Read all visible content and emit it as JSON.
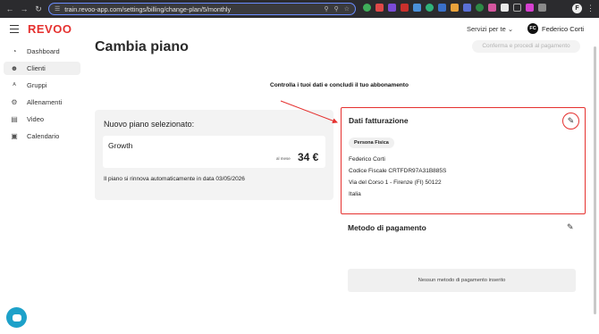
{
  "browser": {
    "url": "train.revoo-app.com/settings/billing/change-plan/5/monthly",
    "back_icon": "arrow-left-icon",
    "forward_icon": "arrow-right-icon",
    "reload_icon": "reload-icon",
    "profile_initial": "F"
  },
  "header": {
    "logo": "REVOO",
    "services_label": "Servizi per te",
    "user_initials": "FC",
    "user_name": "Federico Corti"
  },
  "sidebar": {
    "items": [
      {
        "label": "Dashboard",
        "icon": "dashboard-icon"
      },
      {
        "label": "Clienti",
        "icon": "user-icon"
      },
      {
        "label": "Gruppi",
        "icon": "group-icon"
      },
      {
        "label": "Allenamenti",
        "icon": "workout-icon"
      },
      {
        "label": "Video",
        "icon": "video-icon"
      },
      {
        "label": "Calendario",
        "icon": "calendar-icon"
      }
    ],
    "active_index": 1
  },
  "main": {
    "title": "Cambia piano",
    "confirm_label": "Conferma e procedi al pagamento",
    "hint": "Controlla i tuoi dati e concludi il tuo abbonamento"
  },
  "plan": {
    "heading": "Nuovo piano selezionato:",
    "name": "Growth",
    "per_month": "al mese",
    "price": "34 €",
    "renew_text": "Il piano si rinnova automaticamente in data 03/05/2026"
  },
  "billing": {
    "title": "Dati fatturazione",
    "badge": "Persona Fisica",
    "name": "Federico Corti",
    "tax_code": "Codice Fiscale CRTFDR97A31B885S",
    "address": "Via del Corso 1 - Firenze (FI) 50122",
    "country": "Italia"
  },
  "payment": {
    "title": "Metodo di pagamento",
    "empty_text": "Nessun metodo di pagamento inserito"
  },
  "colors": {
    "accent": "#e5312f",
    "chat": "#1da1c9"
  }
}
